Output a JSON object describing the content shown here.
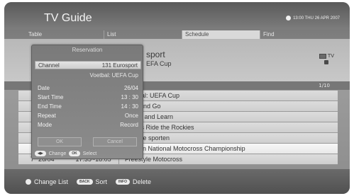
{
  "header": {
    "title": "TV Guide",
    "clock": "13:00 THU 26 APR 2007"
  },
  "tabs": [
    {
      "label": "Table"
    },
    {
      "label": "List"
    },
    {
      "label": "Schedule"
    },
    {
      "label": "Find"
    }
  ],
  "info": {
    "title_fragment": "sport",
    "subtitle_fragment": "EFA Cup",
    "badge_tv": "TV"
  },
  "pager": "1/10",
  "list": [
    {
      "num": "",
      "date": "",
      "time": "",
      "program": "Voetbal: UEFA Cup"
    },
    {
      "num": "",
      "date": "",
      "time": "",
      "program": "Stop and Go"
    },
    {
      "num": "",
      "date": "",
      "time": "",
      "program": "Laugh and Learn"
    },
    {
      "num": "",
      "date": "",
      "time": "",
      "program": "Groms Ride the Rockies"
    },
    {
      "num": "",
      "date": "",
      "time": "",
      "program": "Diverse sporten"
    },
    {
      "num": "",
      "date": "",
      "time": "",
      "program": "Belgian National Motocross Championship"
    },
    {
      "num": "7",
      "date": "26/04",
      "time": "17:35~18:05",
      "program": "Freestyle Motocross"
    }
  ],
  "dialog": {
    "title": "Reservation",
    "channel_label": "Channel",
    "channel_value": "131 Eurosport",
    "program_value": "Voetbal: UEFA Cup",
    "date_label": "Date",
    "date_value": "26/04",
    "start_label": "Start Time",
    "start_value": "13 : 30",
    "end_label": "End Time",
    "end_value": "14 : 30",
    "repeat_label": "Repeat",
    "repeat_value": "Once",
    "mode_label": "Mode",
    "mode_value": "Record",
    "ok_label": "OK",
    "cancel_label": "Cancel",
    "hint_change": "Change",
    "hint_select": "Select",
    "hint_ok_key": "OK"
  },
  "footer": {
    "change_list": "Change List",
    "back_key": "BACK",
    "sort": "Sort",
    "info_key": "INFO",
    "delete": "Delete"
  }
}
